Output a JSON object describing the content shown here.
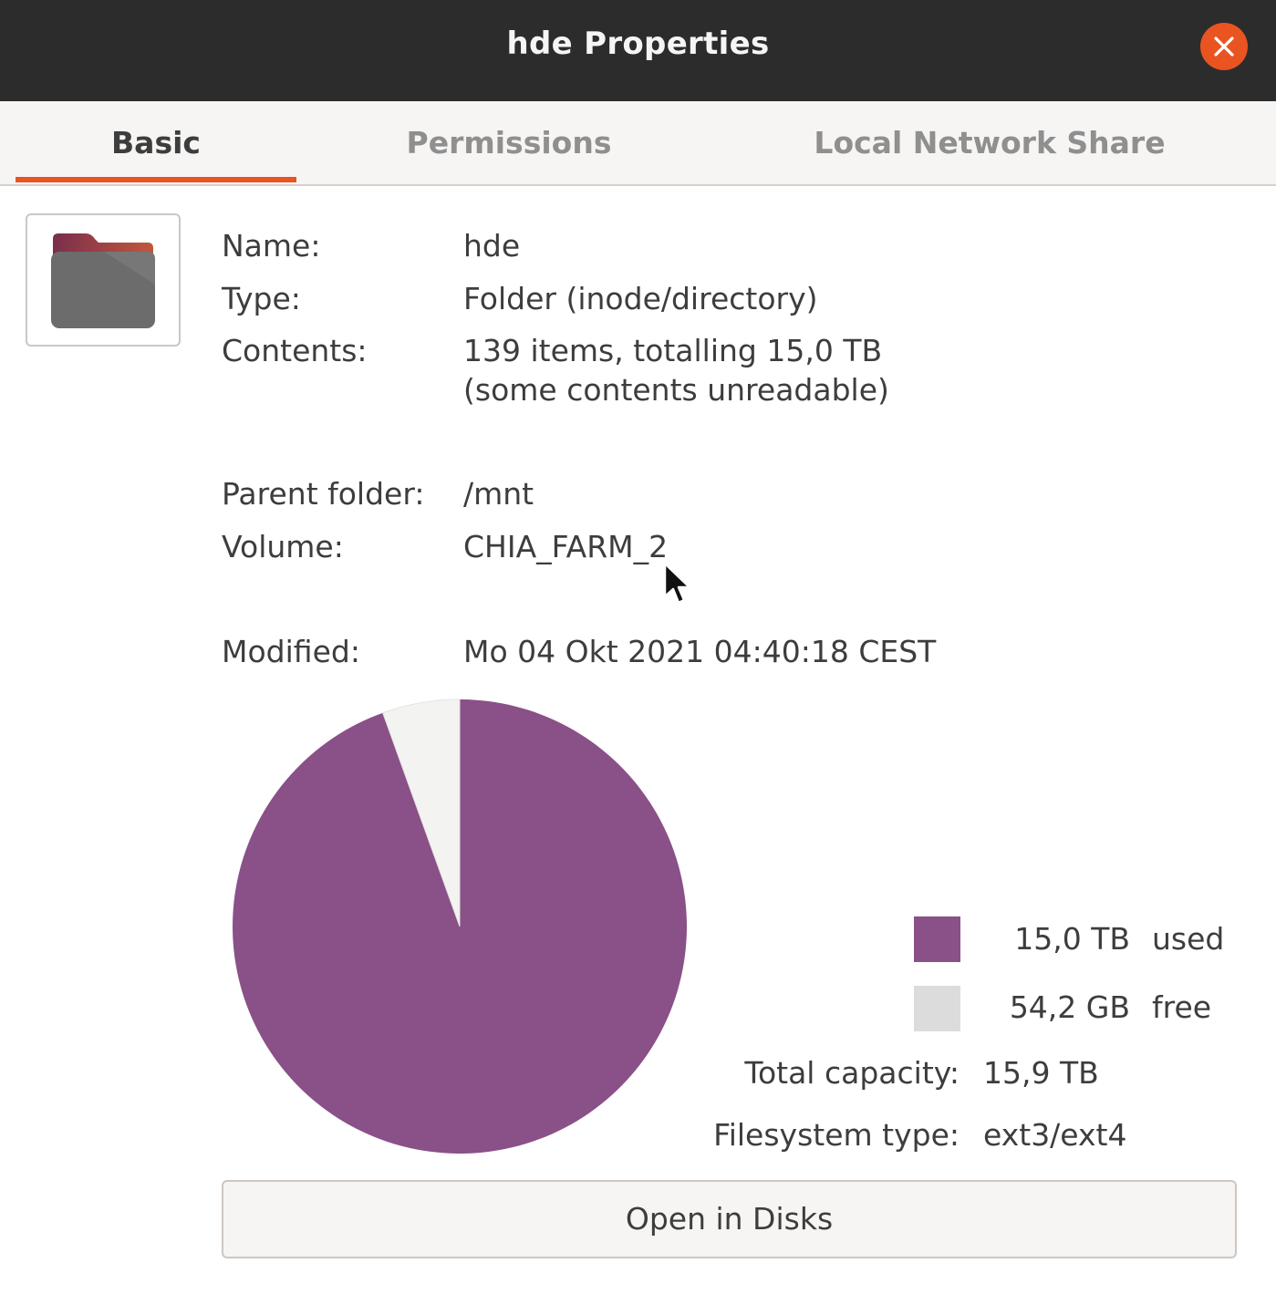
{
  "window": {
    "title": "hde Properties",
    "accent_color": "#e95420"
  },
  "tabs": [
    {
      "label": "Basic",
      "active": true
    },
    {
      "label": "Permissions",
      "active": false
    },
    {
      "label": "Local Network Share",
      "active": false
    }
  ],
  "icon": {
    "name": "folder-icon"
  },
  "info": {
    "name_label": "Name:",
    "name_value": "hde",
    "type_label": "Type:",
    "type_value": "Folder (inode/directory)",
    "contents_label": "Contents:",
    "contents_line1": "139 items, totalling 15,0 TB",
    "contents_line2": "(some contents unreadable)",
    "parent_label": "Parent folder:",
    "parent_value": "/mnt",
    "volume_label": "Volume:",
    "volume_value": "CHIA_FARM_2",
    "modified_label": "Modified:",
    "modified_value": "Mo 04 Okt 2021 04:40:18 CEST"
  },
  "usage": {
    "used_amount": "15,0 TB",
    "used_word": "used",
    "used_color": "#8a5088",
    "free_amount": "54,2 GB",
    "free_word": "free",
    "free_color": "#dcdcdc",
    "free_slice_color": "#f3f4f1",
    "used_fraction": 0.9966,
    "total_label": "Total capacity:",
    "total_value": "15,9 TB",
    "fs_label": "Filesystem type:",
    "fs_value": "ext3/ext4"
  },
  "actions": {
    "open_disks_label": "Open in Disks"
  }
}
